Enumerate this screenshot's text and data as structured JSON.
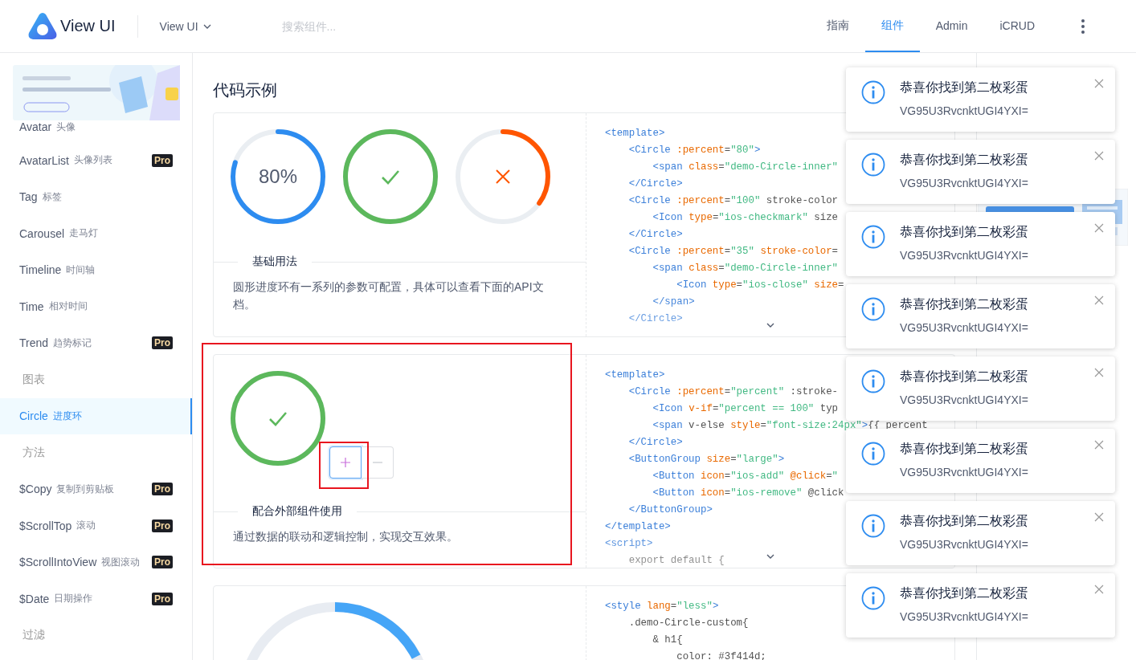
{
  "header": {
    "logo_text": "View UI",
    "version_menu": "View UI",
    "search": {
      "placeholder": "搜索组件..."
    },
    "nav": [
      {
        "label": "指南",
        "selected": false
      },
      {
        "label": "组件",
        "selected": true
      },
      {
        "label": "Admin",
        "selected": false
      },
      {
        "label": "iCRUD",
        "selected": false
      }
    ]
  },
  "sidebar": {
    "items": [
      {
        "kind": "item",
        "name": "Avatar",
        "sub": "头像",
        "selected": false
      },
      {
        "kind": "item",
        "name": "AvatarList",
        "sub": "头像列表",
        "badge": "Pro",
        "selected": false
      },
      {
        "kind": "item",
        "name": "Tag",
        "sub": "标签",
        "selected": false
      },
      {
        "kind": "item",
        "name": "Carousel",
        "sub": "走马灯",
        "selected": false
      },
      {
        "kind": "item",
        "name": "Timeline",
        "sub": "时间轴",
        "selected": false
      },
      {
        "kind": "item",
        "name": "Time",
        "sub": "相对时间",
        "selected": false
      },
      {
        "kind": "item",
        "name": "Trend",
        "sub": "趋势标记",
        "badge": "Pro",
        "selected": false
      },
      {
        "kind": "group",
        "name": "图表"
      },
      {
        "kind": "item",
        "name": "Circle",
        "sub": "进度环",
        "selected": true
      },
      {
        "kind": "group",
        "name": "方法"
      },
      {
        "kind": "item",
        "name": "$Copy",
        "sub": "复制到剪贴板",
        "badge": "Pro",
        "selected": false
      },
      {
        "kind": "item",
        "name": "$ScrollTop",
        "sub": "滚动",
        "badge": "Pro",
        "selected": false
      },
      {
        "kind": "item",
        "name": "$ScrollIntoView",
        "sub": "视图滚动",
        "badge": "Pro",
        "selected": false
      },
      {
        "kind": "item",
        "name": "$Date",
        "sub": "日期操作",
        "badge": "Pro",
        "selected": false
      },
      {
        "kind": "group",
        "name": "过滤"
      }
    ]
  },
  "main": {
    "title": "代码示例",
    "demos": [
      {
        "kind": "basic",
        "title": "基础用法",
        "description": "圆形进度环有一系列的参数可配置，具体可以查看下面的API文档。",
        "circles": [
          {
            "level": 0.8,
            "color": "#2d8cf0",
            "center": {
              "kind": "text",
              "text": "80%"
            }
          },
          {
            "level": 1,
            "color": "#5cb85c",
            "center": {
              "kind": "check"
            }
          },
          {
            "level": 0.35,
            "color": "#ff5500",
            "center": {
              "kind": "close"
            }
          }
        ],
        "code": [
          "<template>",
          "    <Circle :percent=\"80\">",
          "        <span class=\"demo-Circle-inner\"",
          "    </Circle>",
          "    <Circle :percent=\"100\" stroke-color",
          "        <Icon type=\"ios-checkmark\" size",
          "    </Circle>",
          "    <Circle :percent=\"35\" stroke-color=",
          "        <span class=\"demo-Circle-inner\"",
          "            <Icon type=\"ios-close\" size=",
          "        </span>",
          "    </Circle>"
        ]
      },
      {
        "kind": "buttons",
        "title": "配合外部组件使用",
        "description": "通过数据的联动和逻辑控制，实现交互效果。",
        "circles": [
          {
            "level": 1,
            "color": "#5cb85c",
            "center": {
              "kind": "check"
            }
          }
        ],
        "buttons": [
          {
            "kind": "add",
            "selected": true
          },
          {
            "kind": "remove",
            "selected": false
          }
        ],
        "code": [
          "<template>",
          "    <Circle :percent=\"percent\" :stroke-",
          "        <Icon v-if=\"percent == 100\" typ",
          "        <span v-else style=\"font-size:24px\">{{ percent",
          "    </Circle>",
          "    <ButtonGroup size=\"large\">",
          "        <Button icon=\"ios-add\" @click=\"",
          "        <Button icon=\"ios-remove\" @click",
          "    </ButtonGroup>",
          "</template>",
          "<script>",
          "    export default {"
        ]
      },
      {
        "kind": "custom",
        "code": [
          "<style lang=\"less\">",
          "    .demo-Circle-custom{",
          "        & h1{",
          "            color: #3f414d;"
        ]
      }
    ]
  },
  "notifications": [
    {
      "title": "恭喜你找到第二枚彩蛋",
      "text": "VG95U3RvcnktUGI4YXI="
    },
    {
      "title": "恭喜你找到第二枚彩蛋",
      "text": "VG95U3RvcnktUGI4YXI="
    },
    {
      "title": "恭喜你找到第二枚彩蛋",
      "text": "VG95U3RvcnktUGI4YXI="
    },
    {
      "title": "恭喜你找到第二枚彩蛋",
      "text": "VG95U3RvcnktUGI4YXI="
    },
    {
      "title": "恭喜你找到第二枚彩蛋",
      "text": "VG95U3RvcnktUGI4YXI="
    },
    {
      "title": "恭喜你找到第二枚彩蛋",
      "text": "VG95U3RvcnktUGI4YXI="
    },
    {
      "title": "恭喜你找到第二枚彩蛋",
      "text": "VG95U3RvcnktUGI4YXI="
    },
    {
      "title": "恭喜你找到第二枚彩蛋",
      "text": "VG95U3RvcnktUGI4YXI="
    }
  ],
  "annotations": [
    {
      "kind": "box"
    },
    {
      "kind": "box"
    }
  ]
}
